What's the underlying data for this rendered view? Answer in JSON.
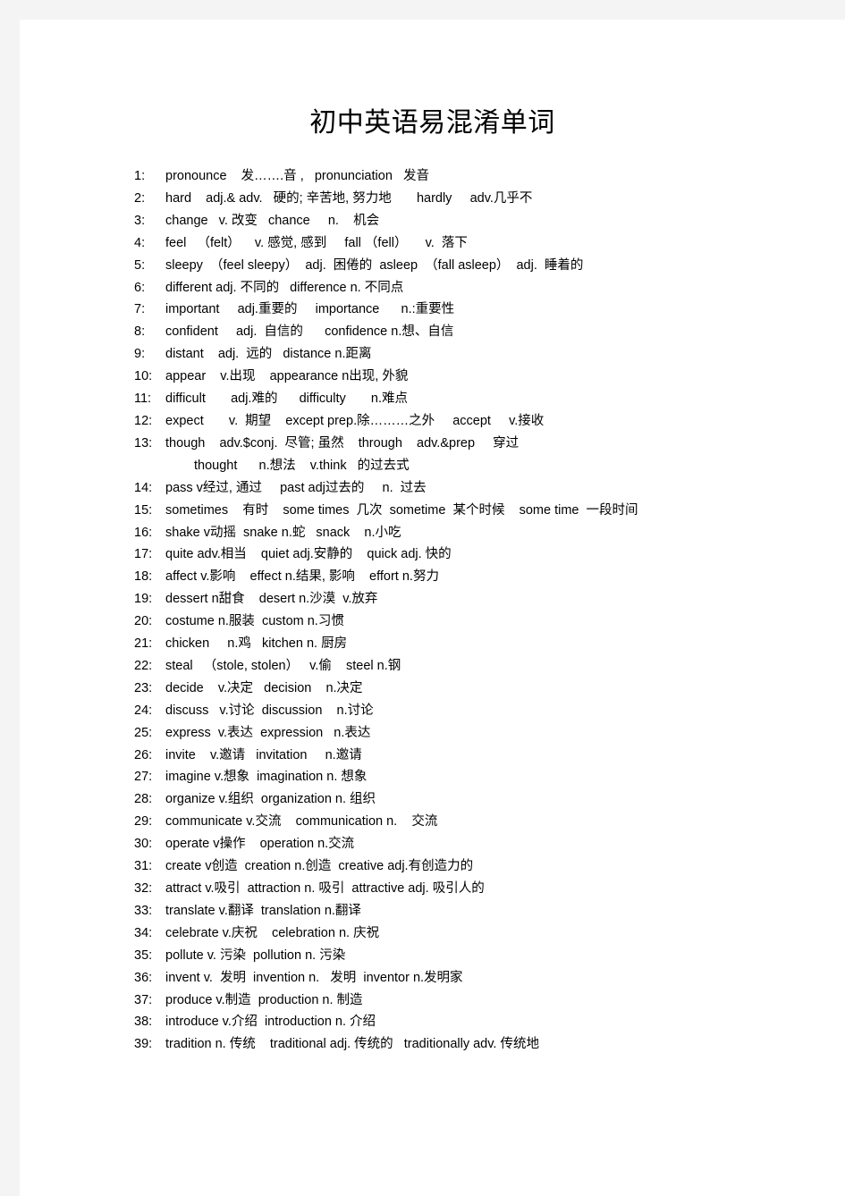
{
  "document": {
    "title": "初中英语易混淆单词",
    "entries": [
      {
        "index": "1:",
        "text": "pronounce    发…….音 ,   pronunciation   发音"
      },
      {
        "index": "2:",
        "text": "hard    adj.& adv.   硬的; 辛苦地, 努力地       hardly     adv.几乎不"
      },
      {
        "index": "3:",
        "text": "change   v. 改变   chance     n.    机会"
      },
      {
        "index": "4:",
        "text": "feel   （felt）    v. 感觉, 感到     fall （fell）     v.  落下"
      },
      {
        "index": "5:",
        "text": "sleepy  （feel sleepy）  adj.  困倦的  asleep  （fall asleep）  adj.  睡着的"
      },
      {
        "index": "6:",
        "text": "different adj. 不同的   difference n. 不同点"
      },
      {
        "index": "7:",
        "text": "important     adj.重要的     importance      n.:重要性"
      },
      {
        "index": "8:",
        "text": "confident     adj.  自信的      confidence n.想、自信"
      },
      {
        "index": "9:",
        "text": "distant    adj.  远的   distance n.距离"
      },
      {
        "index": "10:",
        "text": "appear    v.出现    appearance n出现, 外貌"
      },
      {
        "index": "11:",
        "text": "difficult       adj.难的      difficulty       n.难点"
      },
      {
        "index": "12:",
        "text": "expect       v.  期望    except prep.除………之外     accept     v.接收"
      },
      {
        "index": "13:",
        "text": "though    adv.$conj.  尽管; 虽然    through    adv.&prep     穿过"
      },
      {
        "index": "",
        "text": "thought      n.想法    v.think   的过去式",
        "continuation": true
      },
      {
        "index": "14:",
        "text": "pass v经过, 通过     past adj过去的     n.  过去"
      },
      {
        "index": "15:",
        "text": "sometimes    有时    some times  几次  sometime  某个时候    some time  一段时间"
      },
      {
        "index": "16:",
        "text": "shake v动摇  snake n.蛇   snack    n.小吃"
      },
      {
        "index": "17:",
        "text": "quite adv.相当    quiet adj.安静的    quick adj. 快的"
      },
      {
        "index": "18:",
        "text": "affect v.影响    effect n.结果, 影响    effort n.努力"
      },
      {
        "index": "19:",
        "text": "dessert n甜食    desert n.沙漠  v.放弃"
      },
      {
        "index": "20:",
        "text": "costume n.服装  custom n.习惯"
      },
      {
        "index": "21:",
        "text": "chicken     n.鸡   kitchen n. 厨房"
      },
      {
        "index": "22:",
        "text": "steal   （stole, stolen）   v.偷    steel n.钢"
      },
      {
        "index": "23:",
        "text": "decide    v.决定   decision    n.决定"
      },
      {
        "index": "24:",
        "text": "discuss   v.讨论  discussion    n.讨论"
      },
      {
        "index": "25:",
        "text": "express  v.表达  expression   n.表达"
      },
      {
        "index": "26:",
        "text": "invite    v.邀请   invitation     n.邀请"
      },
      {
        "index": "27:",
        "text": "imagine v.想象  imagination n. 想象"
      },
      {
        "index": "28:",
        "text": "organize v.组织  organization n. 组织"
      },
      {
        "index": "29:",
        "text": "communicate v.交流    communication n.    交流"
      },
      {
        "index": "30:",
        "text": "operate v操作    operation n.交流"
      },
      {
        "index": "31:",
        "text": "create v创造  creation n.创造  creative adj.有创造力的"
      },
      {
        "index": "32:",
        "text": "attract v.吸引  attraction n. 吸引  attractive adj. 吸引人的"
      },
      {
        "index": "33:",
        "text": "translate v.翻译  translation n.翻译"
      },
      {
        "index": "34:",
        "text": "celebrate v.庆祝    celebration n. 庆祝"
      },
      {
        "index": "35:",
        "text": "pollute v. 污染  pollution n. 污染"
      },
      {
        "index": "36:",
        "text": "invent v.  发明  invention n.   发明  inventor n.发明家"
      },
      {
        "index": "37:",
        "text": "produce v.制造  production n. 制造"
      },
      {
        "index": "38:",
        "text": "introduce v.介绍  introduction n. 介绍"
      },
      {
        "index": "39:",
        "text": "tradition n. 传统    traditional adj. 传统的   traditionally adv. 传统地"
      }
    ]
  }
}
